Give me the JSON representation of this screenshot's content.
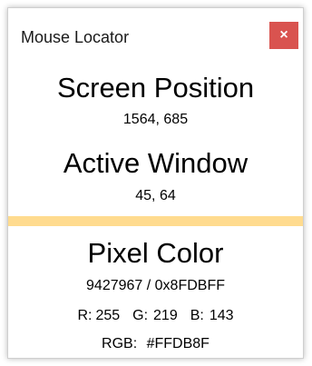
{
  "window": {
    "title": "Mouse Locator",
    "close_glyph": "×",
    "close_icon": "close-icon"
  },
  "screen_position": {
    "heading": "Screen Position",
    "value": "1564, 685"
  },
  "active_window": {
    "heading": "Active Window",
    "value": "45, 64"
  },
  "pixel_color": {
    "heading": "Pixel Color",
    "decimal_hex": "9427967 / 0x8FDBFF",
    "r_label": "R:",
    "r_value": "255",
    "g_label": "G:",
    "g_value": "219",
    "b_label": "B:",
    "b_value": "143",
    "rgb_label": "RGB:",
    "rgb_value": "#FFDB8F",
    "swatch_color": "#FFDB8F"
  },
  "colors": {
    "close_button": "#D9534F",
    "band": "#FFDB8F"
  }
}
